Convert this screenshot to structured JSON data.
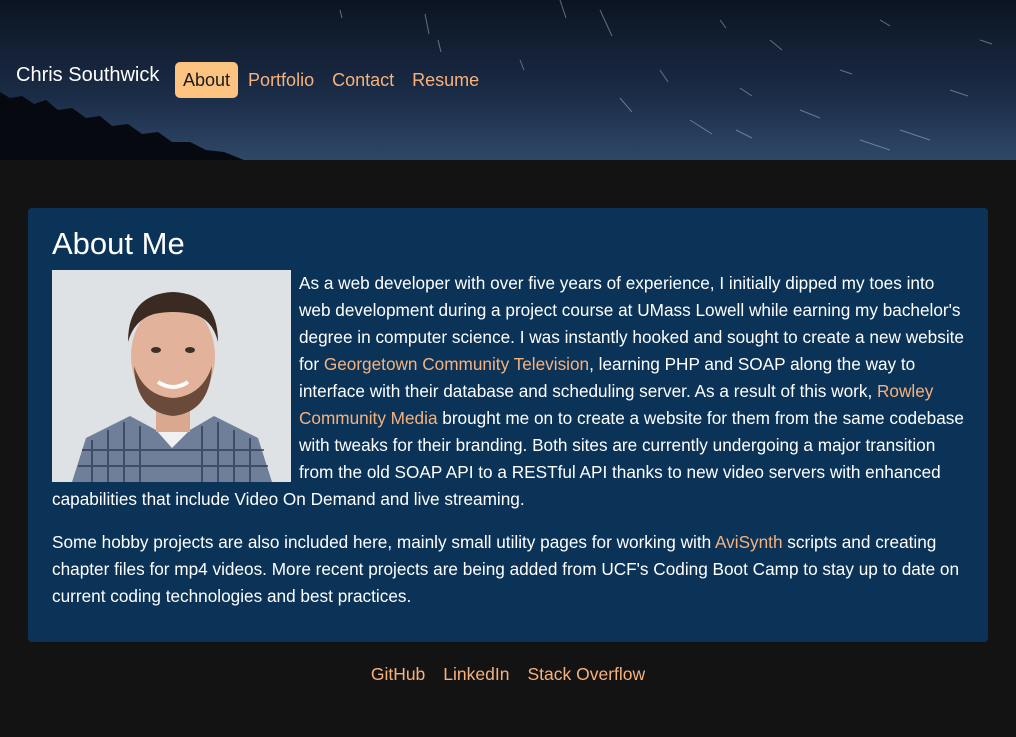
{
  "header": {
    "brand": "Chris Southwick",
    "nav": [
      {
        "label": "About",
        "active": true
      },
      {
        "label": "Portfolio",
        "active": false
      },
      {
        "label": "Contact",
        "active": false
      },
      {
        "label": "Resume",
        "active": false
      }
    ]
  },
  "about": {
    "title": "About Me",
    "photo_icon": "profile-photo",
    "p1": {
      "t1": "As a web developer with over five years of experience, I initially dipped my toes into web development during a project course at UMass Lowell while earning my bachelor's degree in computer science. I was instantly hooked and sought to create a new website for ",
      "link1": "Georgetown Community Television",
      "t2": ", learning PHP and SOAP along the way to interface with their database and scheduling server. As a result of this work, ",
      "link2": "Rowley Community Media",
      "t3": " brought me on to create a website for them from the same codebase with tweaks for their branding. Both sites are currently undergoing a major transition from the old SOAP API to a RESTful API thanks to new video servers with enhanced capabilities that include Video On Demand and live streaming."
    },
    "p2": {
      "t1": "Some hobby projects are also included here, mainly small utility pages for working with ",
      "link1": "AviSynth",
      "t2": " scripts and creating chapter files for mp4 videos. More recent projects are being added from UCF's Coding Boot Camp to stay up to date on current coding technologies and best practices."
    }
  },
  "footer": {
    "links": [
      "GitHub",
      "LinkedIn",
      "Stack Overflow"
    ]
  },
  "colors": {
    "accent": "#f7b27c",
    "active_pill": "#fcc27f",
    "card_bg": "#0b3358",
    "page_bg": "#131313"
  }
}
